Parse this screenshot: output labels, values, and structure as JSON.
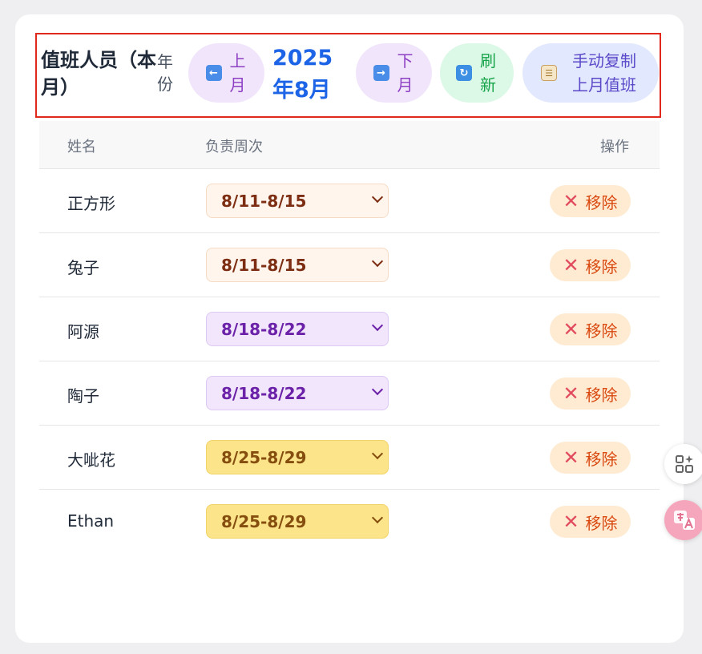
{
  "toolbar": {
    "title": "值班人员（本月）",
    "year_label": "年份",
    "prev_label": "上月",
    "month_display": "2025年8月",
    "next_label": "下月",
    "refresh_label": "刷新",
    "copy_label": "手动复制上月值班"
  },
  "table": {
    "headers": {
      "name": "姓名",
      "week": "负责周次",
      "action": "操作"
    },
    "remove_label": "移除",
    "rows": [
      {
        "name": "正方形",
        "week": "8/11-8/15"
      },
      {
        "name": "兔子",
        "week": "8/11-8/15"
      },
      {
        "name": "阿源",
        "week": "8/18-8/22"
      },
      {
        "name": "陶子",
        "week": "8/18-8/22"
      },
      {
        "name": "大呲花",
        "week": "8/25-8/29"
      },
      {
        "name": "Ethan",
        "week": "8/25-8/29"
      }
    ]
  },
  "colors": {
    "week_1": {
      "bg": "#fff5ec",
      "border": "#f6dbc4",
      "text": "#7c2d12"
    },
    "week_2": {
      "bg": "#f1e6fc",
      "border": "#ddc9f3",
      "text": "#6b21a8"
    },
    "week_3": {
      "bg": "#fbe48a",
      "border": "#f1d467",
      "text": "#854d0e"
    }
  },
  "icons": [
    "arrow-left-icon",
    "arrow-right-icon",
    "refresh-icon",
    "clipboard-icon",
    "close-icon",
    "apps-sparkle-icon",
    "translate-icon"
  ]
}
